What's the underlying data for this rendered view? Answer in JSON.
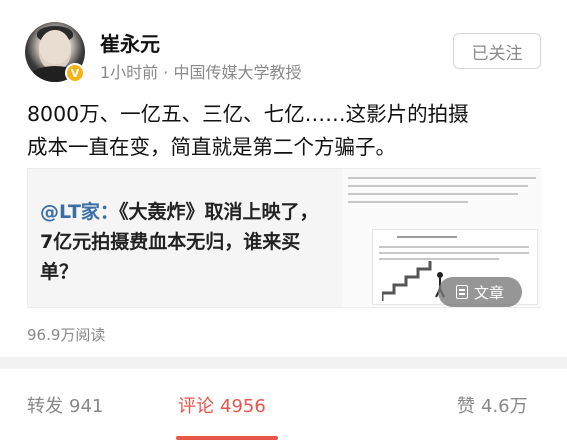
{
  "author": {
    "name": "崔永元",
    "time": "1小时前",
    "separator": " · ",
    "source": "中国传媒大学教授",
    "verified_badge": "V"
  },
  "follow_button": "已关注",
  "post": {
    "line1": "8000万、一亿五、三亿、七亿……这影片的拍摄",
    "line2": "成本一直在变，简直就是第二个方骗子。"
  },
  "card": {
    "at_prefix": "@LT家：",
    "text": "《大轰炸》取消上映了，7亿元拍摄费血本无归，谁来买单？",
    "badge_label": "文章"
  },
  "reads": "96.9万阅读",
  "actions": {
    "repost_label": "转发",
    "repost_count": "941",
    "comment_label": "评论",
    "comment_count": "4956",
    "like_label": "赞",
    "like_count": "4.6万"
  },
  "colors": {
    "accent": "#e8554a",
    "link": "#3a6ea5",
    "muted": "#8a8a8a",
    "verified": "#f6b315"
  }
}
